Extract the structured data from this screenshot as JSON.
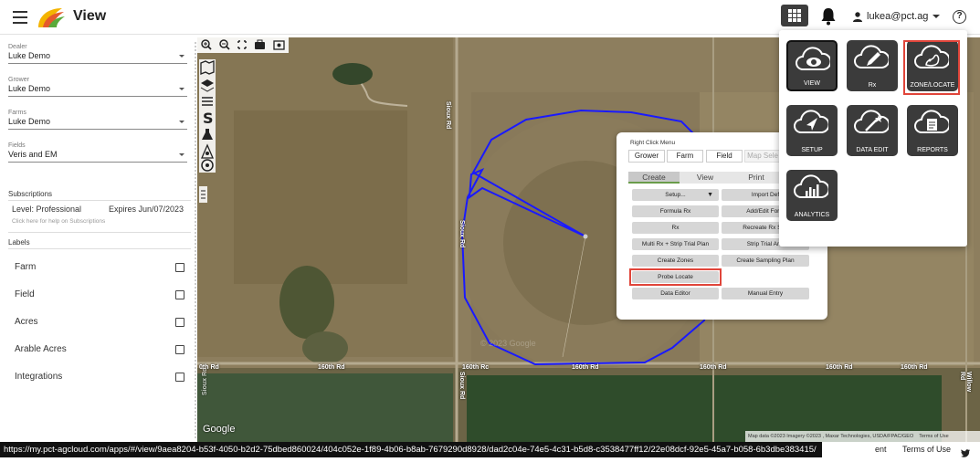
{
  "header": {
    "title": "View",
    "user": "lukea@pct.ag",
    "help": "?"
  },
  "sidebar": {
    "dealer": {
      "label": "Dealer",
      "value": "Luke Demo"
    },
    "grower": {
      "label": "Grower",
      "value": "Luke Demo"
    },
    "farms": {
      "label": "Farms",
      "value": "Luke Demo"
    },
    "fields": {
      "label": "Fields",
      "value": "Veris and EM"
    },
    "subscriptions": {
      "title": "Subscriptions",
      "level": "Level: Professional",
      "expires": "Expires Jun/07/2023",
      "help": "Click here for help on Subscriptions"
    },
    "labels": {
      "title": "Labels",
      "items": [
        "Farm",
        "Field",
        "Acres",
        "Arable Acres",
        "Integrations"
      ]
    }
  },
  "map": {
    "google": "Google",
    "attribution": "Map data ©2023 Imagery ©2023 , Maxar Technologies, USDA/FPAC/GEO",
    "terms": "Terms of Use",
    "watermark": "© 2023 Google",
    "roads": [
      "0th Rd",
      "160th Rd",
      "160th Rc",
      "160th Rd",
      "160th Rd",
      "160th Rd",
      "160th Rd"
    ],
    "vroads": [
      "Sioux Rd",
      "Sioux Rd",
      "Sioux Rd",
      "Willow Rd",
      "Sioux Rd"
    ]
  },
  "context_menu": {
    "title": "Right Click Menu",
    "scope_tabs": [
      "Grower",
      "Farm",
      "Field",
      "Map Sele"
    ],
    "view_tabs": [
      "Create",
      "View",
      "Print"
    ],
    "buttons_left": [
      "Setup...",
      "Formula Rx",
      "Rx",
      "Multi Rx + Strip Trial Plan",
      "Create Zones",
      "Probe Locate",
      "Data Editor"
    ],
    "buttons_right": [
      "Import Def",
      "Add/Edit Form",
      "Recreate Rx Sha",
      "Strip Trial Ana",
      "Create Sampling Plan",
      "Manual Entry"
    ],
    "setup_caret": "▼"
  },
  "apps_menu": {
    "items": [
      "VIEW",
      "Rx",
      "ZONE/LOCATE",
      "SETUP",
      "DATA EDIT",
      "REPORTS",
      "ANALYTICS"
    ]
  },
  "status": {
    "url": "https://my.pct-agcloud.com/apps/#/view/9aea8204-b53f-4050-b2d2-75dbed860024/404c052e-1f89-4b06-b8ab-7679290d8928/dad2c04e-74e5-4c31-b5d8-c3538477ff12/22e08dcf-92e5-45a7-b058-6b3dbe383415/",
    "overflow_text": "ent",
    "terms": "Terms of Use"
  },
  "colors": {
    "accent": "#e0453a",
    "field_boundary": "#1a1aff",
    "icon_bg": "#3b3b3b"
  }
}
